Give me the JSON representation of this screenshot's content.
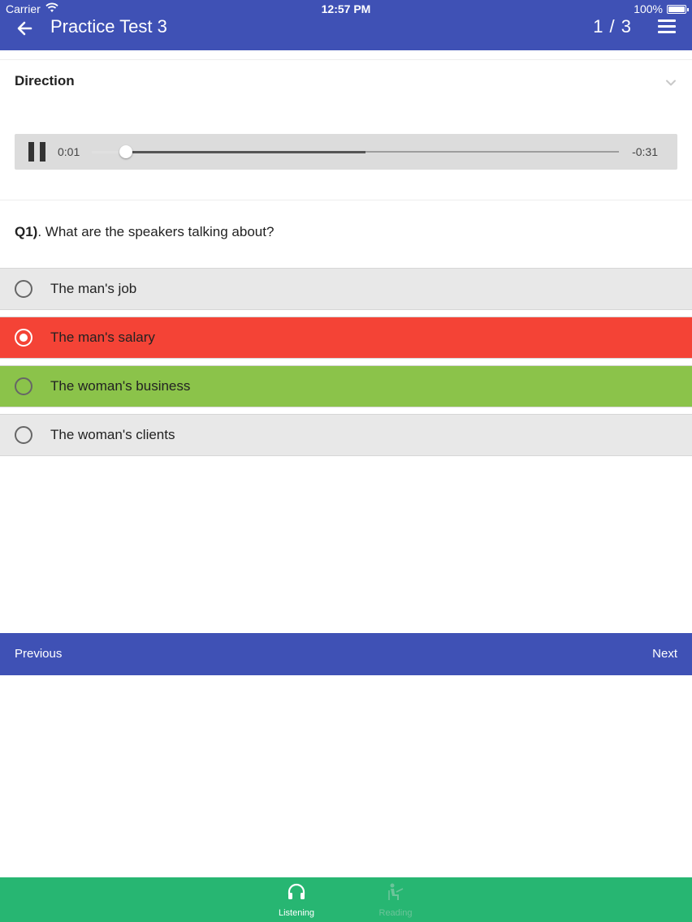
{
  "status_bar": {
    "carrier": "Carrier",
    "time": "12:57 PM",
    "battery": "100%"
  },
  "app_bar": {
    "title": "Practice Test 3",
    "counter": "1 / 3",
    "back_icon": "arrow-left-icon",
    "menu_icon": "hamburger-menu-icon"
  },
  "direction": {
    "label": "Direction",
    "expand_icon": "chevron-down-icon"
  },
  "audio_player": {
    "elapsed": "0:01",
    "remaining": "-0:31",
    "progress": 0.065,
    "buffered": 0.52,
    "state_icon": "pause-icon"
  },
  "question": {
    "number": "Q1)",
    "text": ". What are the speakers talking about?"
  },
  "options": [
    {
      "label": "The man's job",
      "state": "neutral",
      "selected": false
    },
    {
      "label": "The man's salary",
      "state": "wrong",
      "selected": true
    },
    {
      "label": "The woman's business",
      "state": "correct",
      "selected": false
    },
    {
      "label": "The woman's clients",
      "state": "neutral",
      "selected": false
    }
  ],
  "navigation": {
    "previous": "Previous",
    "next": "Next"
  },
  "tabs": [
    {
      "label": "Listening",
      "icon": "headphones-icon",
      "active": true
    },
    {
      "label": "Reading",
      "icon": "reading-person-icon",
      "active": false
    }
  ],
  "colors": {
    "primary": "#3f51b5",
    "wrong": "#f44336",
    "correct": "#8bc34a",
    "neutral": "#e8e8e8",
    "tab_bar": "#27b672"
  }
}
